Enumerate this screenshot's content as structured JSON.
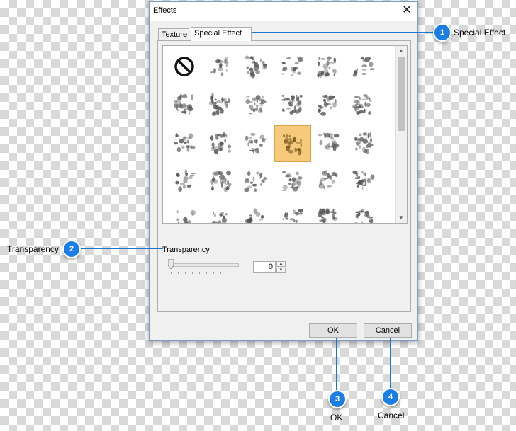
{
  "dialog": {
    "title": "Effects",
    "close_glyph": "✕",
    "tabs": [
      {
        "label": "Texture",
        "active": false
      },
      {
        "label": "Special Effect",
        "active": true
      }
    ],
    "gallery": {
      "selected_index": 15,
      "items": [
        "no-effect-icon",
        "grass-stroke-icon",
        "vertical-texture-icon",
        "blob-pattern-icon",
        "swirl-texture-icon",
        "feather-texture-icon",
        "fold-texture-icon",
        "tentacle-texture-icon",
        "shell-texture-icon",
        "splatter-texture-icon",
        "leaf-texture-icon",
        "dots-texture-icon",
        "sprout-texture-icon",
        "machine-texture-icon",
        "sketch-texture-icon",
        "diamond-texture-icon",
        "flag-texture-icon",
        "dense-dots-texture-icon",
        "block-texture-icon",
        "bars-texture-icon",
        "circles-texture-icon",
        "noise-texture-icon",
        "vine-texture-icon",
        "rough-texture-icon",
        "dust-texture-icon",
        "brush-texture-icon",
        "fan-texture-icon",
        "cityline-texture-icon",
        "tree-texture-icon",
        "scribble-texture-icon"
      ]
    },
    "transparency": {
      "label": "Transparency",
      "value": "0"
    },
    "buttons": {
      "ok": "OK",
      "cancel": "Cancel"
    }
  },
  "callouts": [
    {
      "number": "1",
      "text": "Special Effect"
    },
    {
      "number": "2",
      "text": "Transparency"
    },
    {
      "number": "3",
      "text": "OK"
    },
    {
      "number": "4",
      "text": "Cancel"
    }
  ],
  "colors": {
    "callout_blue": "#1a7ee6",
    "selection": "#f7c97a"
  }
}
